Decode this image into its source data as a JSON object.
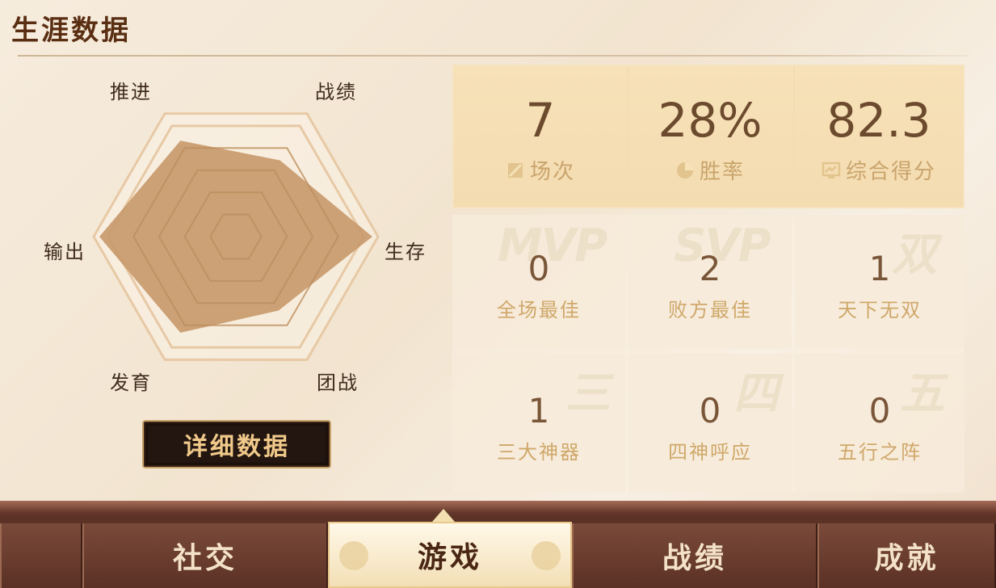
{
  "page_title": "生涯数据",
  "radar": {
    "labels": {
      "push": "推进",
      "record": "战绩",
      "survive": "生存",
      "teamfight": "团战",
      "farm": "发育",
      "damage": "输出"
    },
    "levels": {
      "push": 0.78,
      "record": 0.62,
      "survive": 0.96,
      "teamfight": 0.6,
      "farm": 0.78,
      "damage": 0.96
    },
    "fill_color": "#c89a6c",
    "outline_color": "#e7c9a5"
  },
  "detail_button": "详细数据",
  "summary": [
    {
      "value": "7",
      "label": "场次",
      "icon": "chart-box-icon"
    },
    {
      "value": "28%",
      "label": "胜率",
      "icon": "pie-chart-icon"
    },
    {
      "value": "82.3",
      "label": "综合得分",
      "icon": "monitor-chart-icon"
    }
  ],
  "honors": [
    {
      "value": "0",
      "label": "全场最佳",
      "watermark": "MVP"
    },
    {
      "value": "2",
      "label": "败方最佳",
      "watermark": "SVP"
    },
    {
      "value": "1",
      "label": "天下无双",
      "watermark": "双"
    },
    {
      "value": "1",
      "label": "三大神器",
      "watermark": "三"
    },
    {
      "value": "0",
      "label": "四神呼应",
      "watermark": "四"
    },
    {
      "value": "0",
      "label": "五行之阵",
      "watermark": "五"
    }
  ],
  "nav": {
    "tabs": [
      "社交",
      "游戏",
      "战绩",
      "成就"
    ],
    "active": "游戏"
  },
  "colors": {
    "accent_gold": "#c9a46c",
    "dark_brown": "#5a2e12",
    "nav_bg": "#5c3226"
  }
}
